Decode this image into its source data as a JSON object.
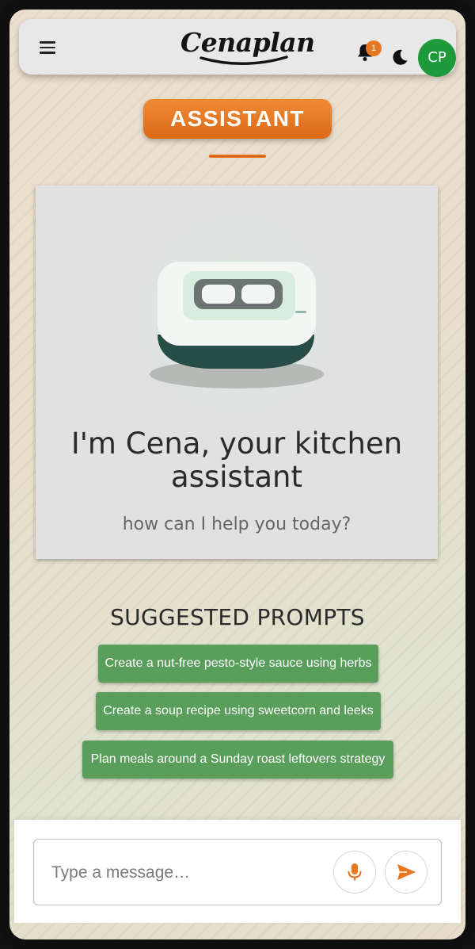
{
  "header": {
    "menu_icon": "hamburger-menu-icon",
    "logo_text": "Cenaplan",
    "notifications": {
      "icon": "bell-icon",
      "count": "1"
    },
    "theme_icon": "moon-icon",
    "avatar_initials": "CP"
  },
  "page": {
    "section_title": "ASSISTANT"
  },
  "hero": {
    "title": "I'm Cena, your kitchen assistant",
    "subtitle": "how can I help you today?"
  },
  "suggested": {
    "heading": "SUGGESTED PROMPTS",
    "prompts": [
      "Create a nut-free pesto-style sauce using herbs",
      "Create a soup recipe using sweetcorn and leeks",
      "Plan meals around a Sunday roast leftovers strategy"
    ]
  },
  "composer": {
    "placeholder": "Type a message…",
    "mic_icon": "microphone-icon",
    "send_icon": "send-icon"
  },
  "colors": {
    "accent_orange": "#e87722",
    "prompt_green": "#5a9e5c",
    "avatar_green": "#1e9a3a"
  }
}
